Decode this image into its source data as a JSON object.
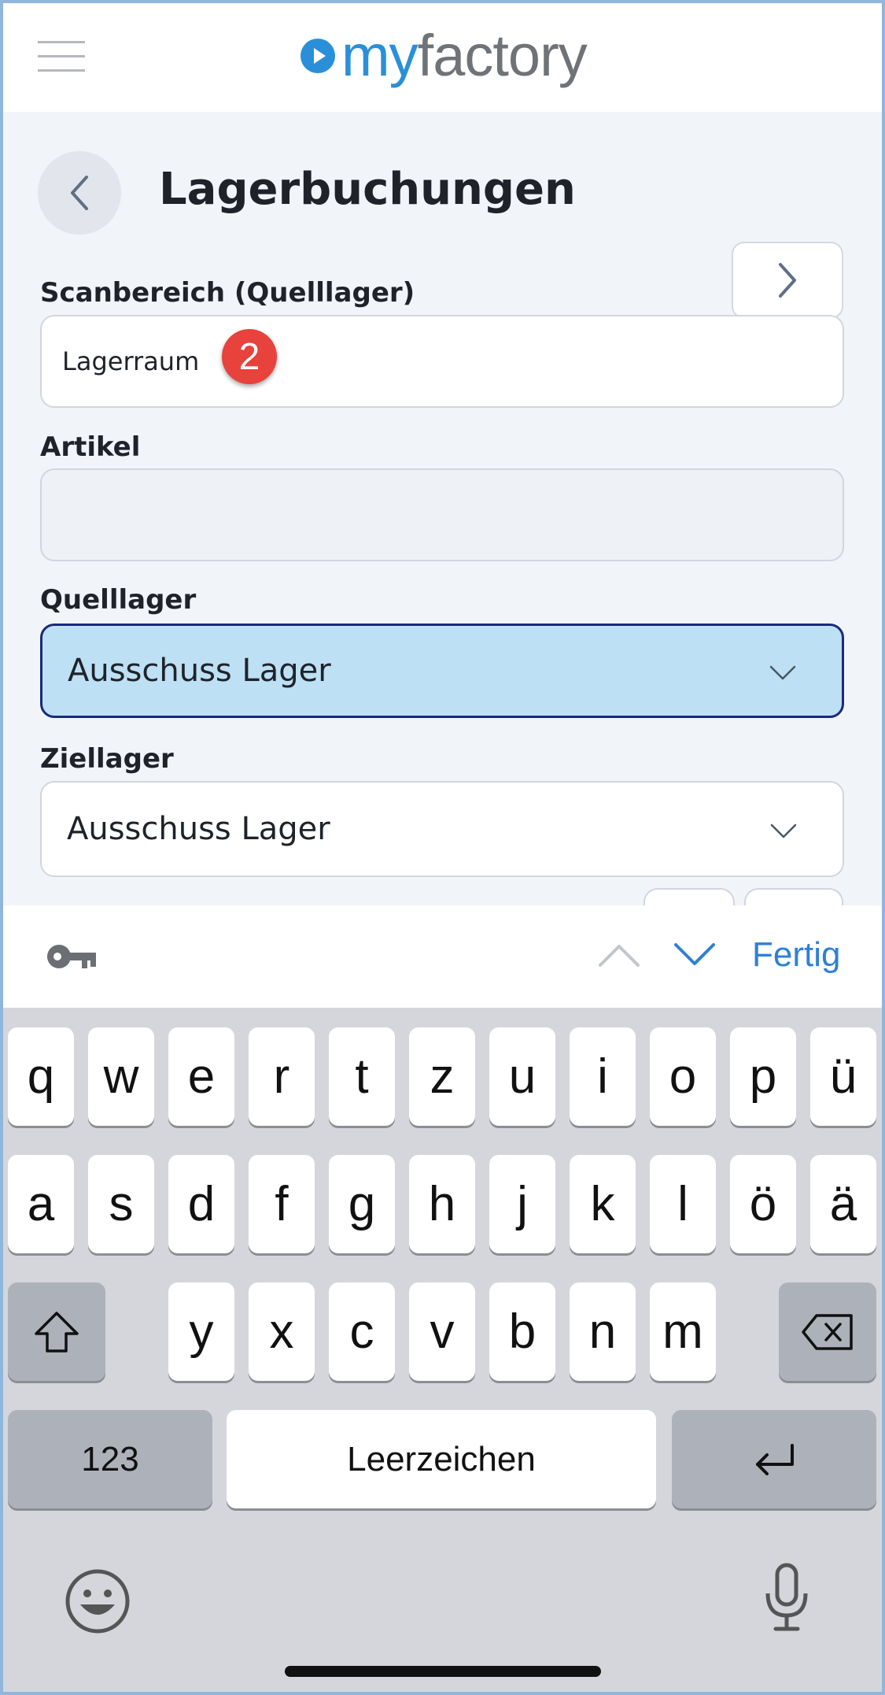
{
  "header": {
    "logo_my": "my",
    "logo_rest": "factory",
    "menu_icon": "hamburger-icon",
    "logo_icon": "play-circle-icon"
  },
  "page": {
    "title": "Lagerbuchungen",
    "back_icon": "chevron-left-icon",
    "next_icon": "chevron-right-icon"
  },
  "form": {
    "scan": {
      "label": "Scanbereich (Quelllager)",
      "value": "Lagerraum"
    },
    "badge": "2",
    "article": {
      "label": "Artikel",
      "value": ""
    },
    "source": {
      "label": "Quelllager",
      "value": "Ausschuss Lager",
      "highlight": "#bde0f4",
      "border": "#1a2a7a"
    },
    "target": {
      "label": "Ziellager",
      "value": "Ausschuss Lager"
    }
  },
  "accessory": {
    "done_label": "Fertig",
    "key_icon": "key-icon",
    "prev_icon": "chevron-up-icon",
    "next_icon": "chevron-down-icon",
    "accent": "#2f7fd8"
  },
  "keyboard": {
    "row1": [
      "q",
      "w",
      "e",
      "r",
      "t",
      "z",
      "u",
      "i",
      "o",
      "p",
      "ü"
    ],
    "row2": [
      "a",
      "s",
      "d",
      "f",
      "g",
      "h",
      "j",
      "k",
      "l",
      "ö",
      "ä"
    ],
    "row3": [
      "y",
      "x",
      "c",
      "v",
      "b",
      "n",
      "m"
    ],
    "numbers_label": "123",
    "space_label": "Leerzeichen",
    "shift_icon": "shift-icon",
    "delete_icon": "backspace-icon",
    "return_icon": "return-icon",
    "emoji_icon": "emoji-icon",
    "mic_icon": "microphone-icon"
  }
}
